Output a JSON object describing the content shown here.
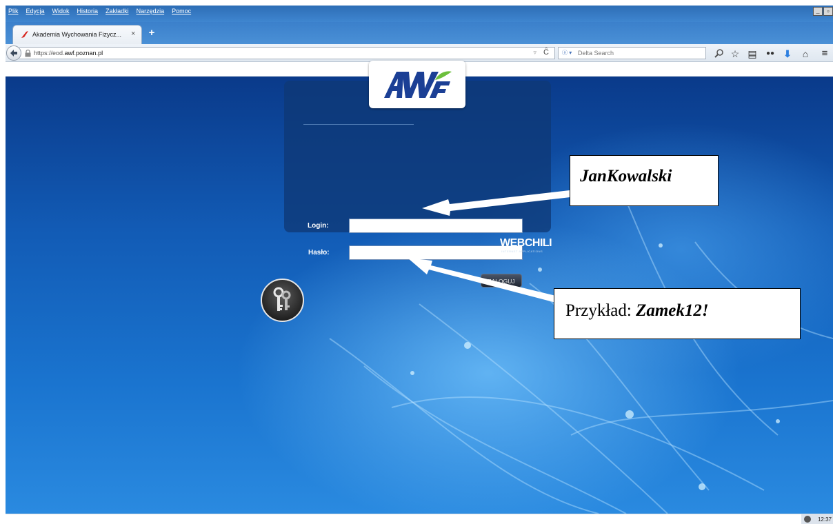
{
  "menu": {
    "items": [
      "Plik",
      "Edycja",
      "Widok",
      "Historia",
      "Zakładki",
      "Narzędzia",
      "Pomoc"
    ]
  },
  "tab": {
    "title": "Akademia Wychowania Fizycz...",
    "close": "×",
    "new_tab": "+"
  },
  "navbar": {
    "url_prefix": "https://eod.",
    "url_domain": "awf.poznan.pl",
    "search_placeholder": "Delta Search",
    "search_engine_label": "ⓐ ▾"
  },
  "login": {
    "logo_text": "AWF",
    "login_label": "Login:",
    "login_value": "",
    "password_label": "Hasło:",
    "password_value": "",
    "submit_label": "ZALOGUJ",
    "vendor": "WEBCHILI",
    "vendor_sub": "INTERNET APPLICATIONS"
  },
  "annotations": {
    "login_example": "JanKowalski",
    "password_prefix": "Przykład: ",
    "password_example": "Zamek12!"
  },
  "statusbar": {
    "clock": "12:37"
  },
  "colors": {
    "accent": "#3f86d0",
    "page_bg": "#125bb5",
    "panel": "#0e3876",
    "logo_blue": "#1b3f95",
    "logo_green": "#6cbf3c"
  }
}
